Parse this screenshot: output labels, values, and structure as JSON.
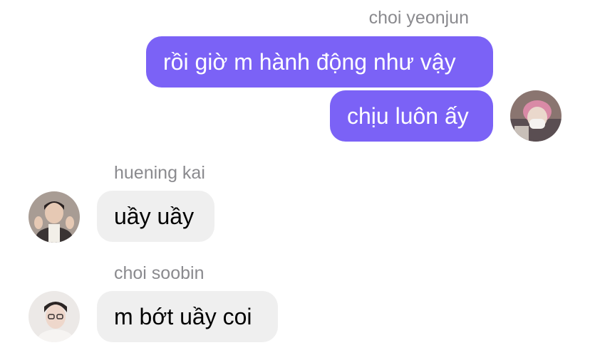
{
  "chat": {
    "messages": [
      {
        "sender": "choi yeonjun",
        "direction": "outgoing",
        "texts": [
          "rồi giờ m hành động như vậy",
          "chịu luôn ấy"
        ],
        "avatar_icon": "user-avatar-yeonjun"
      },
      {
        "sender": "huening kai",
        "direction": "incoming",
        "texts": [
          "uầy uầy"
        ],
        "avatar_icon": "user-avatar-kai"
      },
      {
        "sender": "choi soobin",
        "direction": "incoming",
        "texts": [
          "m bớt uầy coi"
        ],
        "avatar_icon": "user-avatar-soobin"
      }
    ]
  },
  "colors": {
    "outgoing_bubble": "#7b62f6",
    "incoming_bubble": "#efefef",
    "sender_name": "#8a8a8e"
  }
}
